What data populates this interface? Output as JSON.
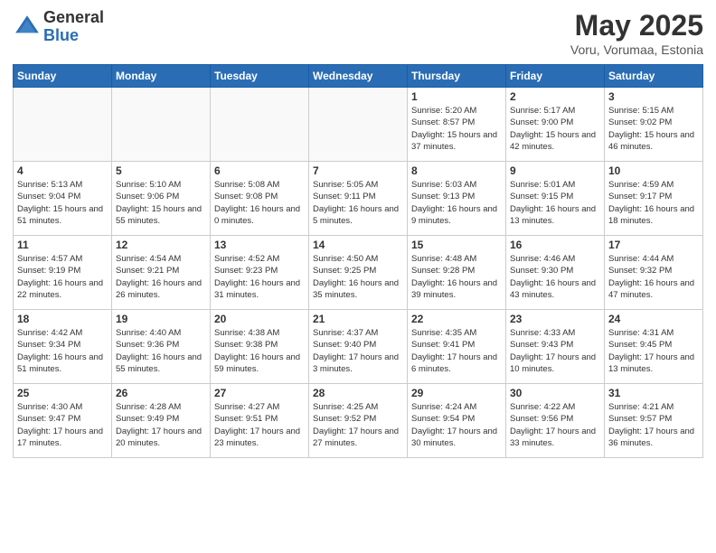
{
  "logo": {
    "general": "General",
    "blue": "Blue"
  },
  "title": {
    "month": "May 2025",
    "location": "Voru, Vorumaa, Estonia"
  },
  "weekdays": [
    "Sunday",
    "Monday",
    "Tuesday",
    "Wednesday",
    "Thursday",
    "Friday",
    "Saturday"
  ],
  "weeks": [
    [
      {
        "day": "",
        "info": ""
      },
      {
        "day": "",
        "info": ""
      },
      {
        "day": "",
        "info": ""
      },
      {
        "day": "",
        "info": ""
      },
      {
        "day": "1",
        "info": "Sunrise: 5:20 AM\nSunset: 8:57 PM\nDaylight: 15 hours\nand 37 minutes."
      },
      {
        "day": "2",
        "info": "Sunrise: 5:17 AM\nSunset: 9:00 PM\nDaylight: 15 hours\nand 42 minutes."
      },
      {
        "day": "3",
        "info": "Sunrise: 5:15 AM\nSunset: 9:02 PM\nDaylight: 15 hours\nand 46 minutes."
      }
    ],
    [
      {
        "day": "4",
        "info": "Sunrise: 5:13 AM\nSunset: 9:04 PM\nDaylight: 15 hours\nand 51 minutes."
      },
      {
        "day": "5",
        "info": "Sunrise: 5:10 AM\nSunset: 9:06 PM\nDaylight: 15 hours\nand 55 minutes."
      },
      {
        "day": "6",
        "info": "Sunrise: 5:08 AM\nSunset: 9:08 PM\nDaylight: 16 hours\nand 0 minutes."
      },
      {
        "day": "7",
        "info": "Sunrise: 5:05 AM\nSunset: 9:11 PM\nDaylight: 16 hours\nand 5 minutes."
      },
      {
        "day": "8",
        "info": "Sunrise: 5:03 AM\nSunset: 9:13 PM\nDaylight: 16 hours\nand 9 minutes."
      },
      {
        "day": "9",
        "info": "Sunrise: 5:01 AM\nSunset: 9:15 PM\nDaylight: 16 hours\nand 13 minutes."
      },
      {
        "day": "10",
        "info": "Sunrise: 4:59 AM\nSunset: 9:17 PM\nDaylight: 16 hours\nand 18 minutes."
      }
    ],
    [
      {
        "day": "11",
        "info": "Sunrise: 4:57 AM\nSunset: 9:19 PM\nDaylight: 16 hours\nand 22 minutes."
      },
      {
        "day": "12",
        "info": "Sunrise: 4:54 AM\nSunset: 9:21 PM\nDaylight: 16 hours\nand 26 minutes."
      },
      {
        "day": "13",
        "info": "Sunrise: 4:52 AM\nSunset: 9:23 PM\nDaylight: 16 hours\nand 31 minutes."
      },
      {
        "day": "14",
        "info": "Sunrise: 4:50 AM\nSunset: 9:25 PM\nDaylight: 16 hours\nand 35 minutes."
      },
      {
        "day": "15",
        "info": "Sunrise: 4:48 AM\nSunset: 9:28 PM\nDaylight: 16 hours\nand 39 minutes."
      },
      {
        "day": "16",
        "info": "Sunrise: 4:46 AM\nSunset: 9:30 PM\nDaylight: 16 hours\nand 43 minutes."
      },
      {
        "day": "17",
        "info": "Sunrise: 4:44 AM\nSunset: 9:32 PM\nDaylight: 16 hours\nand 47 minutes."
      }
    ],
    [
      {
        "day": "18",
        "info": "Sunrise: 4:42 AM\nSunset: 9:34 PM\nDaylight: 16 hours\nand 51 minutes."
      },
      {
        "day": "19",
        "info": "Sunrise: 4:40 AM\nSunset: 9:36 PM\nDaylight: 16 hours\nand 55 minutes."
      },
      {
        "day": "20",
        "info": "Sunrise: 4:38 AM\nSunset: 9:38 PM\nDaylight: 16 hours\nand 59 minutes."
      },
      {
        "day": "21",
        "info": "Sunrise: 4:37 AM\nSunset: 9:40 PM\nDaylight: 17 hours\nand 3 minutes."
      },
      {
        "day": "22",
        "info": "Sunrise: 4:35 AM\nSunset: 9:41 PM\nDaylight: 17 hours\nand 6 minutes."
      },
      {
        "day": "23",
        "info": "Sunrise: 4:33 AM\nSunset: 9:43 PM\nDaylight: 17 hours\nand 10 minutes."
      },
      {
        "day": "24",
        "info": "Sunrise: 4:31 AM\nSunset: 9:45 PM\nDaylight: 17 hours\nand 13 minutes."
      }
    ],
    [
      {
        "day": "25",
        "info": "Sunrise: 4:30 AM\nSunset: 9:47 PM\nDaylight: 17 hours\nand 17 minutes."
      },
      {
        "day": "26",
        "info": "Sunrise: 4:28 AM\nSunset: 9:49 PM\nDaylight: 17 hours\nand 20 minutes."
      },
      {
        "day": "27",
        "info": "Sunrise: 4:27 AM\nSunset: 9:51 PM\nDaylight: 17 hours\nand 23 minutes."
      },
      {
        "day": "28",
        "info": "Sunrise: 4:25 AM\nSunset: 9:52 PM\nDaylight: 17 hours\nand 27 minutes."
      },
      {
        "day": "29",
        "info": "Sunrise: 4:24 AM\nSunset: 9:54 PM\nDaylight: 17 hours\nand 30 minutes."
      },
      {
        "day": "30",
        "info": "Sunrise: 4:22 AM\nSunset: 9:56 PM\nDaylight: 17 hours\nand 33 minutes."
      },
      {
        "day": "31",
        "info": "Sunrise: 4:21 AM\nSunset: 9:57 PM\nDaylight: 17 hours\nand 36 minutes."
      }
    ]
  ]
}
